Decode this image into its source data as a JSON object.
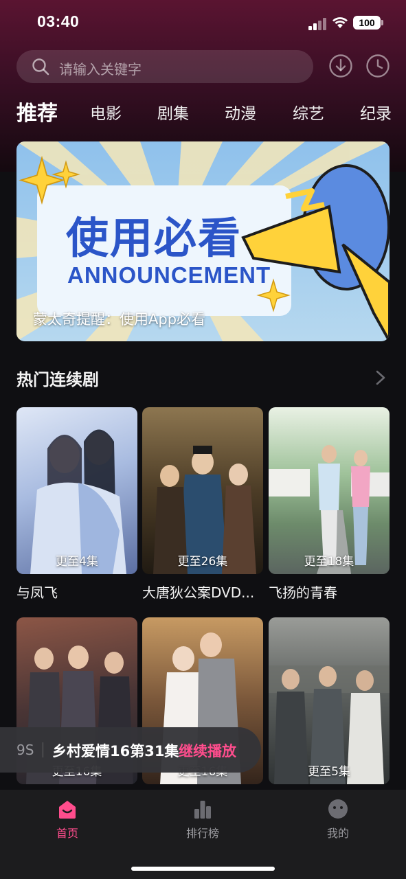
{
  "status_bar": {
    "time": "03:40",
    "battery": "100"
  },
  "search": {
    "placeholder": "请输入关键字"
  },
  "header_icons": [
    "download-icon",
    "history-clock-icon"
  ],
  "category_tabs": [
    {
      "label": "推荐",
      "active": true
    },
    {
      "label": "电影",
      "active": false
    },
    {
      "label": "剧集",
      "active": false
    },
    {
      "label": "动漫",
      "active": false
    },
    {
      "label": "综艺",
      "active": false
    },
    {
      "label": "纪录",
      "active": false
    }
  ],
  "banner": {
    "title": "使用必看",
    "subtitle": "ANNOUNCEMENT",
    "caption": "蒙太奇提醒：使用App必看"
  },
  "section": {
    "title": "热门连续剧"
  },
  "shows": [
    {
      "title": "与凤飞",
      "episodes": "更至4集",
      "colors": [
        "#c8d7ef",
        "#7e95c6"
      ]
    },
    {
      "title": "大唐狄公案DVD...",
      "episodes": "更至26集",
      "colors": [
        "#6e5a3c",
        "#2c2418"
      ]
    },
    {
      "title": "飞扬的青春",
      "episodes": "更至18集",
      "colors": [
        "#cfe2c2",
        "#6f8c72"
      ]
    },
    {
      "title": "",
      "episodes": "更至16集",
      "colors": [
        "#7a4b3e",
        "#2a2a34"
      ]
    },
    {
      "title": "",
      "episodes": "更至16集",
      "colors": [
        "#b48a5c",
        "#3f2b21"
      ]
    },
    {
      "title": "",
      "episodes": "更至5集",
      "colors": [
        "#7d7f7c",
        "#3a3d3e"
      ]
    }
  ],
  "resume_bar": {
    "time": "9S",
    "title": "乡村爱情16第31集",
    "action": "继续播放"
  },
  "bottom_nav": [
    {
      "label": "首页",
      "icon": "home-icon",
      "active": true
    },
    {
      "label": "排行榜",
      "icon": "bar-chart-icon",
      "active": false
    },
    {
      "label": "我的",
      "icon": "profile-icon",
      "active": false
    }
  ],
  "colors": {
    "accent": "#ff4d8d",
    "background": "#0f0f12",
    "header_gradient_top": "#5a1431"
  }
}
